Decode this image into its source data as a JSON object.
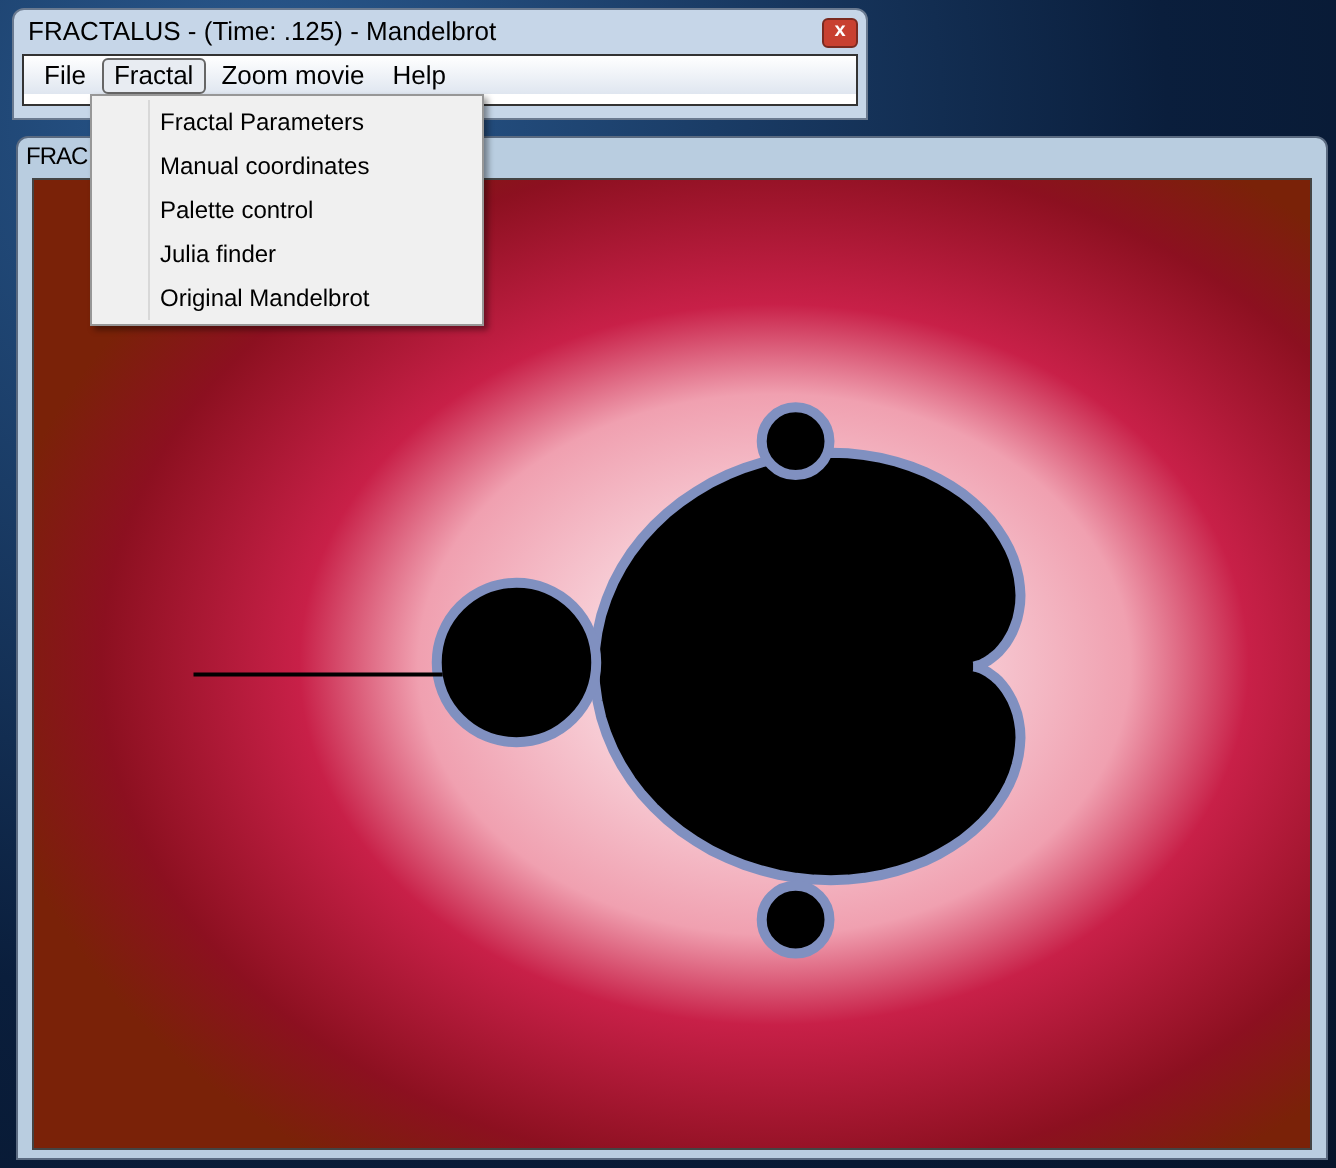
{
  "main_window": {
    "title": "FRACTALUS - (Time: .125) - Mandelbrot",
    "close": "x"
  },
  "menu_bar": [
    {
      "label": "File",
      "selected": false
    },
    {
      "label": "Fractal",
      "selected": true
    },
    {
      "label": "Zoom movie",
      "selected": false
    },
    {
      "label": "Help",
      "selected": false
    }
  ],
  "dropdown": [
    "Fractal Parameters",
    "Manual coordinates",
    "Palette control",
    "Julia finder",
    "Original Mandelbrot"
  ],
  "fractal_window": {
    "title": "FRAC"
  }
}
